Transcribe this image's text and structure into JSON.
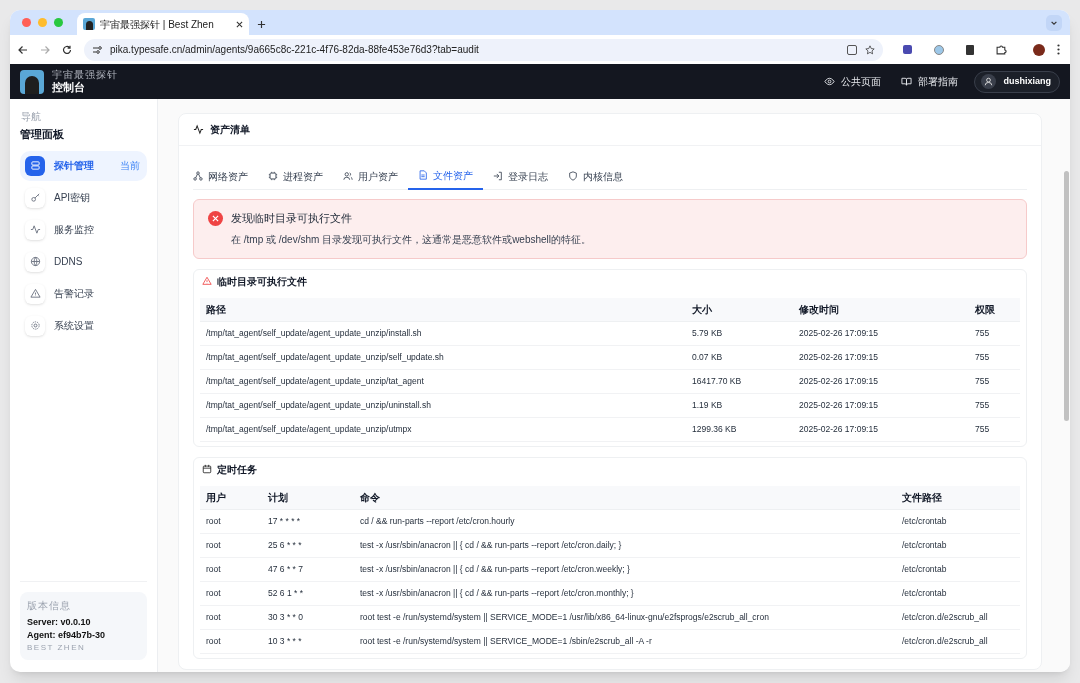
{
  "browser": {
    "tab_title": "宇宙最强探针 | Best Zhen",
    "url": "pika.typesafe.cn/admin/agents/9a665c8c-221c-4f76-82da-88fe453e76d3?tab=audit"
  },
  "app": {
    "subtitle": "宇宙最强探针",
    "title": "控制台",
    "links": [
      {
        "label": "公共页面"
      },
      {
        "label": "部署指南"
      }
    ],
    "user": "dushixiang"
  },
  "sidebar": {
    "caption": "导航",
    "title": "管理面板",
    "items": [
      {
        "label": "探针管理",
        "selected": true,
        "badge": "当前"
      },
      {
        "label": "API密钥",
        "selected": false
      },
      {
        "label": "服务监控",
        "selected": false
      },
      {
        "label": "DDNS",
        "selected": false
      },
      {
        "label": "告警记录",
        "selected": false
      },
      {
        "label": "系统设置",
        "selected": false
      }
    ],
    "version": {
      "caption": "版本信息",
      "server": "Server: v0.0.10",
      "agent": "Agent: ef94b7b-30",
      "brand": "BEST ZHEN"
    }
  },
  "panel": {
    "title": "资产清单",
    "tabs": [
      {
        "label": "网络资产",
        "selected": false
      },
      {
        "label": "进程资产",
        "selected": false
      },
      {
        "label": "用户资产",
        "selected": false
      },
      {
        "label": "文件资产",
        "selected": true
      },
      {
        "label": "登录日志",
        "selected": false
      },
      {
        "label": "内核信息",
        "selected": false
      }
    ],
    "alert": {
      "title": "发现临时目录可执行文件",
      "message": "在 /tmp 或 /dev/shm 目录发现可执行文件，这通常是恶意软件或webshell的特征。"
    },
    "sections": [
      {
        "kind": "warning",
        "title": "临时目录可执行文件",
        "columns": [
          "路径",
          "大小",
          "修改时间",
          "权限"
        ],
        "rows": [
          [
            "/tmp/tat_agent/self_update/agent_update_unzip/install.sh",
            "5.79 KB",
            "2025-02-26 17:09:15",
            "755"
          ],
          [
            "/tmp/tat_agent/self_update/agent_update_unzip/self_update.sh",
            "0.07 KB",
            "2025-02-26 17:09:15",
            "755"
          ],
          [
            "/tmp/tat_agent/self_update/agent_update_unzip/tat_agent",
            "16417.70 KB",
            "2025-02-26 17:09:15",
            "755"
          ],
          [
            "/tmp/tat_agent/self_update/agent_update_unzip/uninstall.sh",
            "1.19 KB",
            "2025-02-26 17:09:15",
            "755"
          ],
          [
            "/tmp/tat_agent/self_update/agent_update_unzip/utmpx",
            "1299.36 KB",
            "2025-02-26 17:09:15",
            "755"
          ]
        ]
      },
      {
        "kind": "schedule",
        "title": "定时任务",
        "columns": [
          "用户",
          "计划",
          "命令",
          "文件路径"
        ],
        "rows": [
          [
            "root",
            "17 * * * *",
            "cd / && run-parts --report /etc/cron.hourly",
            "/etc/crontab"
          ],
          [
            "root",
            "25 6 * * *",
            "test -x /usr/sbin/anacron || { cd / && run-parts --report /etc/cron.daily; }",
            "/etc/crontab"
          ],
          [
            "root",
            "47 6 * * 7",
            "test -x /usr/sbin/anacron || { cd / && run-parts --report /etc/cron.weekly; }",
            "/etc/crontab"
          ],
          [
            "root",
            "52 6 1 * *",
            "test -x /usr/sbin/anacron || { cd / && run-parts --report /etc/cron.monthly; }",
            "/etc/crontab"
          ],
          [
            "root",
            "30 3 * * 0",
            "root test -e /run/systemd/system || SERVICE_MODE=1 /usr/lib/x86_64-linux-gnu/e2fsprogs/e2scrub_all_cron",
            "/etc/cron.d/e2scrub_all"
          ],
          [
            "root",
            "10 3 * * *",
            "root test -e /run/systemd/system || SERVICE_MODE=1 /sbin/e2scrub_all -A -r",
            "/etc/cron.d/e2scrub_all"
          ]
        ]
      }
    ]
  }
}
